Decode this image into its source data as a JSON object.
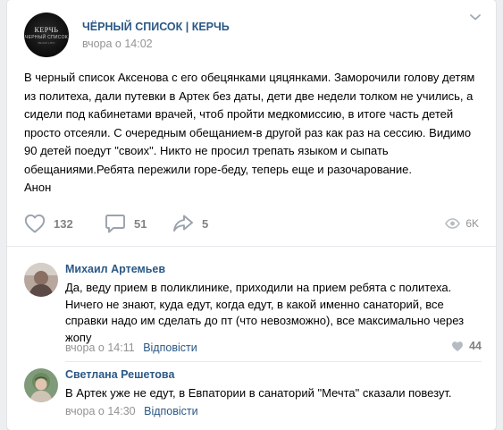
{
  "post": {
    "group_name": "ЧЁРНЫЙ СПИСОК | КЕРЧЬ",
    "date": "вчора о 14:02",
    "avatar_text": {
      "line1": "КЕРЧЬ",
      "line2": "ЧЕРНЫЙ СПИСОК",
      "line3": "(BLACK LIST)"
    },
    "text": "В черный список Аксенова с его обецянками цяцянками. Заморочили голову детям из политеха, дали путевки в Артек без даты, дети две недели толком не учились, а сидели под кабинетами врачей, чтоб пройти медкомиссию, в итоге часть детей просто отсеяли. С очередным обещанием-в другой раз как раз на сессию. Видимо 90 детей поедут \"своих\". Никто не просил трепать языком и сыпать обещаниями.Ребята пережили горе-беду, теперь еще и разочарование.",
    "signature": "Анон",
    "likes": "132",
    "comments": "51",
    "shares": "5",
    "views": "6K"
  },
  "comments": [
    {
      "author": "Михаил Артемьев",
      "text": "Да, веду прием в поликлинике, приходили на прием ребята с политеха. Ничего не знают, куда едут, когда едут, в какой именно санаторий, все справки надо им сделать до пт (что невозможно), все максимально через жопу",
      "date": "вчора о 14:11",
      "reply_label": "Відповісти",
      "likes": "44"
    },
    {
      "author": "Светлана Решетова",
      "text": "В Артек уже не едут, в Евпатории в санаторий \"Мечта\" сказали повезут.",
      "date": "вчора о 14:30",
      "reply_label": "Відповісти"
    }
  ],
  "icons": {
    "like": "heart-icon",
    "comment": "speech-bubble-icon",
    "share": "share-arrow-icon",
    "views": "eye-icon",
    "more": "chevron-down-icon"
  },
  "colors": {
    "link": "#2a5885",
    "muted": "#939393",
    "icon": "#828282",
    "background": "#edeef0"
  }
}
